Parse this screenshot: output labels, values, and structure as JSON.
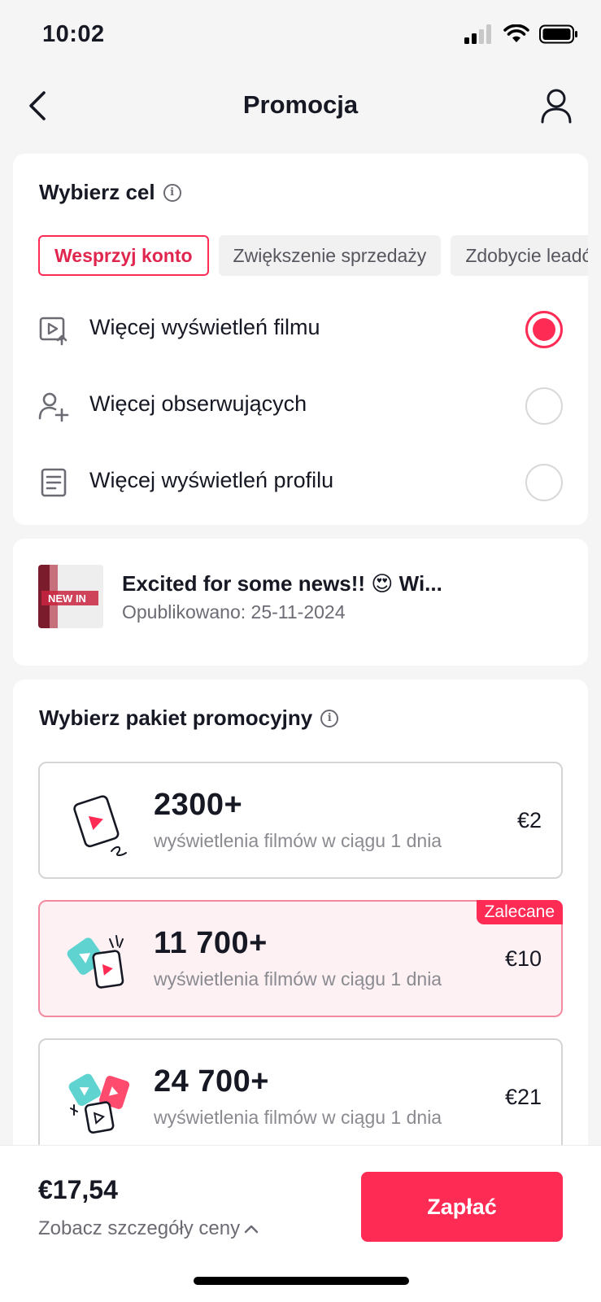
{
  "status": {
    "time": "10:02"
  },
  "nav": {
    "title": "Promocja"
  },
  "goal": {
    "title": "Wybierz cel",
    "chips": [
      {
        "label": "Wesprzyj konto",
        "active": true
      },
      {
        "label": "Zwiększenie sprzedaży",
        "active": false
      },
      {
        "label": "Zdobycie leadów",
        "active": false
      }
    ],
    "options": [
      {
        "label": "Więcej wyświetleń filmu",
        "icon": "video-play-icon",
        "selected": true
      },
      {
        "label": "Więcej obserwujących",
        "icon": "add-user-icon",
        "selected": false
      },
      {
        "label": "Więcej wyświetleń profilu",
        "icon": "document-icon",
        "selected": false
      }
    ]
  },
  "video": {
    "title": "Excited for some news!! 😍 Wi...",
    "date": "Opublikowano: 25-11-2024",
    "thumb_text": "NEW IN"
  },
  "packages": {
    "title": "Wybierz pakiet promocyjny",
    "items": [
      {
        "count": "2300+",
        "desc": "wyświetlenia filmów w ciągu 1 dnia",
        "price": "€2",
        "badge": ""
      },
      {
        "count": "11 700+",
        "desc": "wyświetlenia filmów w ciągu 1 dnia",
        "price": "€10",
        "badge": "Zalecane"
      },
      {
        "count": "24 700+",
        "desc": "wyświetlenia filmów w ciągu 1 dnia",
        "price": "€21",
        "badge": ""
      }
    ]
  },
  "footer": {
    "total": "€17,54",
    "details_label": "Zobacz szczegóły ceny",
    "pay_label": "Zapłać"
  },
  "colors": {
    "accent": "#fe2c55",
    "recommended_bg": "#fdf1f3",
    "teal": "#5fd3d0"
  }
}
